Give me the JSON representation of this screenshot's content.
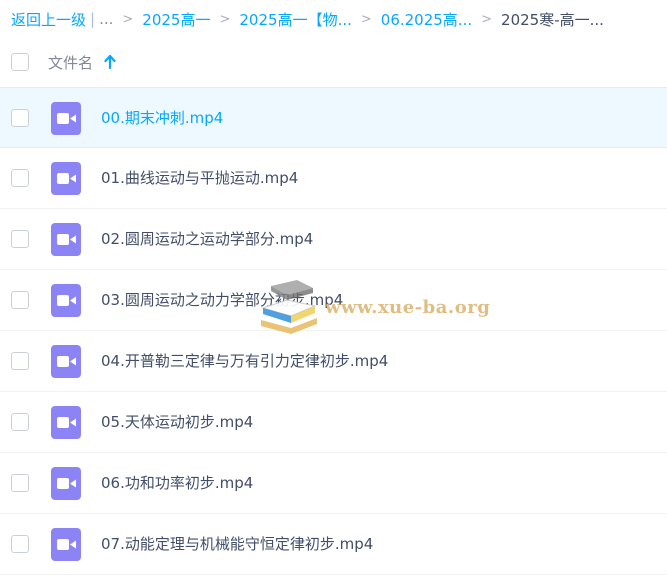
{
  "breadcrumb": {
    "back_label": "返回上一级",
    "separator": "|",
    "ellipsis": "...",
    "arrow": ">",
    "items": [
      "2025高一",
      "2025高一【物...",
      "06.2025高...",
      "2025寒-高一..."
    ]
  },
  "header": {
    "column_label": "文件名",
    "sort_icon": "arrow-up-icon"
  },
  "files": [
    {
      "name": "00.期末冲刺.mp4",
      "selected": true
    },
    {
      "name": "01.曲线运动与平抛运动.mp4"
    },
    {
      "name": "02.圆周运动之运动学部分.mp4"
    },
    {
      "name": "03.圆周运动之动力学部分初步.mp4"
    },
    {
      "name": "04.开普勒三定律与万有引力定律初步.mp4"
    },
    {
      "name": "05.天体运动初步.mp4"
    },
    {
      "name": "06.功和功率初步.mp4"
    },
    {
      "name": "07.动能定理与机械能守恒定律初步.mp4"
    }
  ],
  "file_icon": "video-file-icon",
  "watermark": {
    "text": "www.xue-ba.org",
    "icon": "books-logo-icon"
  },
  "colors": {
    "accent": "#06a7ff",
    "video_icon": "#8c84f4",
    "selected_row": "#eef8ff",
    "text": "#424e67",
    "watermark": "#d6a858"
  }
}
